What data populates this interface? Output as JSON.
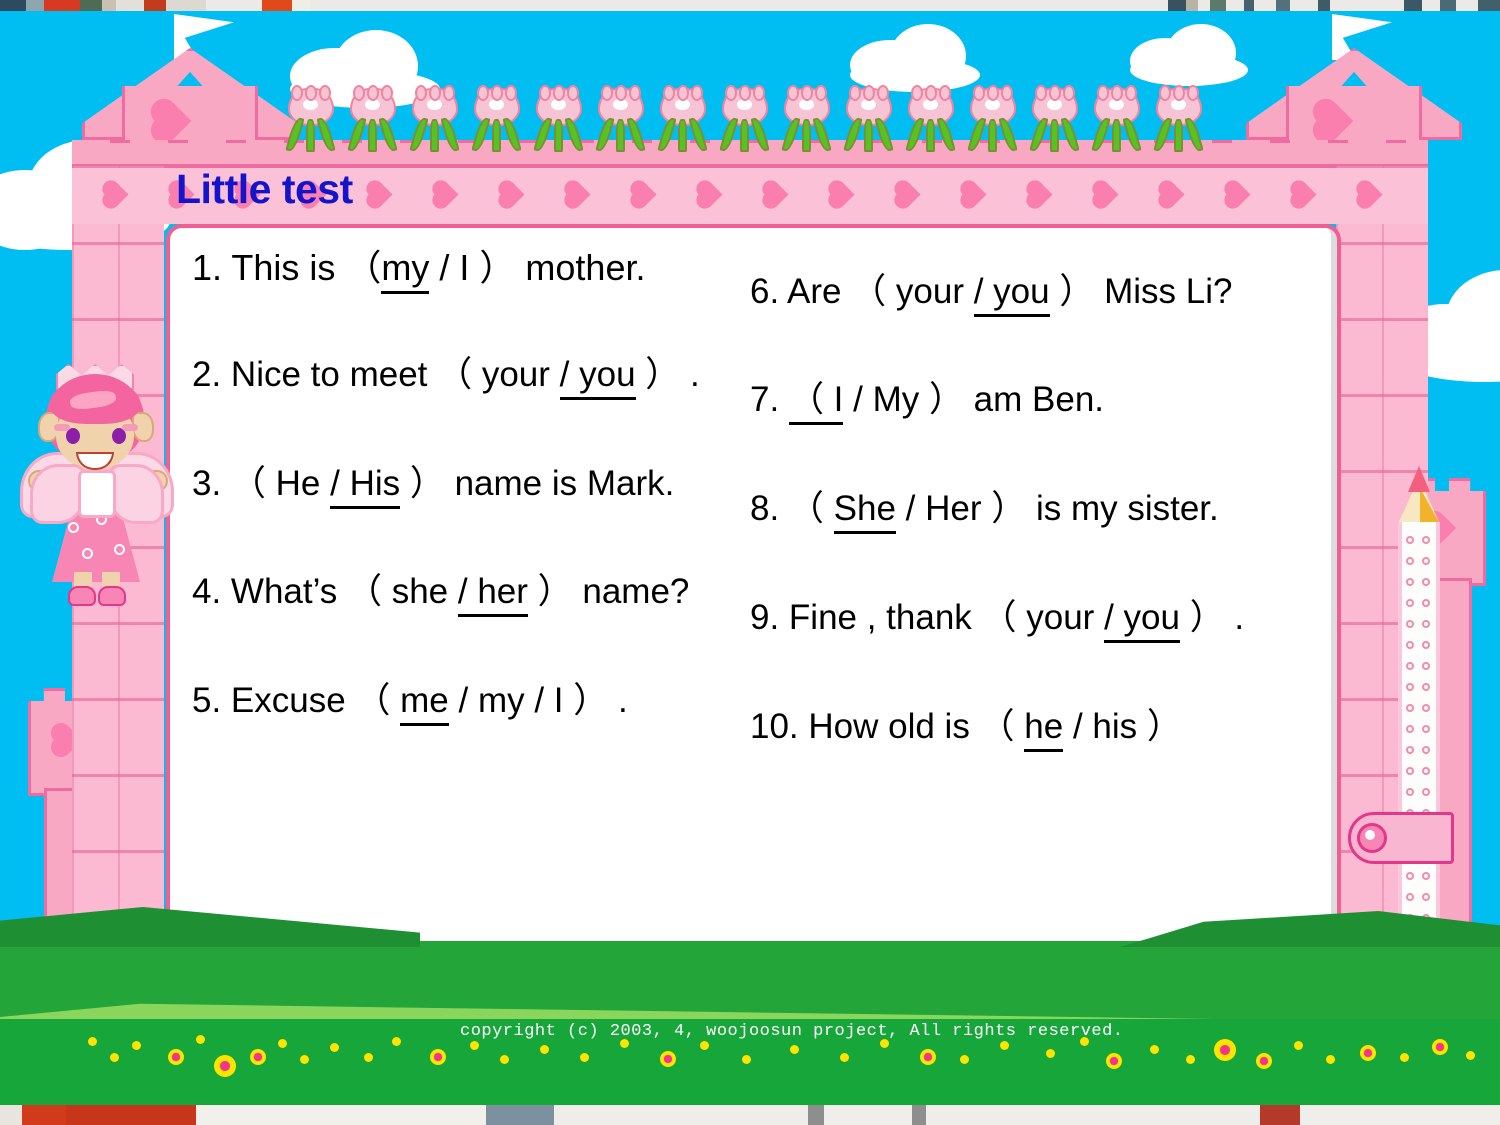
{
  "slide": {
    "title": "Little test",
    "title_color": "#1414cc",
    "sky_color": "#00bdf2",
    "castle_color": "#f9a8c4",
    "frame_color": "#fbb9d2",
    "grass_color": "#16a63a",
    "copyright": "copyright (c) 2003, 4, woojoosun project, All rights reserved."
  },
  "questions": {
    "left_column": [
      {
        "number": "1.",
        "segments": [
          {
            "text": "  This is  （",
            "underline": false
          },
          {
            "text": "my",
            "underline": true
          },
          {
            "text": " / I ）  mother.",
            "underline": false
          }
        ]
      },
      {
        "number": "2.",
        "segments": [
          {
            "text": " Nice to meet  （ your ",
            "underline": false
          },
          {
            "text": "/ you",
            "underline": true
          },
          {
            "text": " ）  .",
            "underline": false
          }
        ]
      },
      {
        "number": "3.",
        "segments": [
          {
            "text": "  （ He ",
            "underline": false
          },
          {
            "text": "/ His",
            "underline": true
          },
          {
            "text": " ）  name is Mark.",
            "underline": false
          }
        ]
      },
      {
        "number": "4.",
        "segments": [
          {
            "text": " What’s  （ she ",
            "underline": false
          },
          {
            "text": "/ her",
            "underline": true
          },
          {
            "text": " ）  name?",
            "underline": false
          }
        ]
      },
      {
        "number": "5.",
        "segments": [
          {
            "text": " Excuse  （ ",
            "underline": false
          },
          {
            "text": "me",
            "underline": true
          },
          {
            "text": " / my / I ）  .",
            "underline": false
          }
        ]
      }
    ],
    "right_column": [
      {
        "number": "6.",
        "segments": [
          {
            "text": " Are  （ your ",
            "underline": false
          },
          {
            "text": "/ you",
            "underline": true
          },
          {
            "text": " ）  Miss Li?",
            "underline": false
          }
        ]
      },
      {
        "number": "7.",
        "segments": [
          {
            "text": "  ",
            "underline": false
          },
          {
            "text": "（ I",
            "underline": true
          },
          {
            "text": " / My ）  am Ben.",
            "underline": false
          }
        ]
      },
      {
        "number": "8.",
        "segments": [
          {
            "text": "  （ ",
            "underline": false
          },
          {
            "text": "She",
            "underline": true
          },
          {
            "text": " / Her ）  is my sister.",
            "underline": false
          }
        ]
      },
      {
        "number": "9.",
        "segments": [
          {
            "text": " Fine , thank  （ your ",
            "underline": false
          },
          {
            "text": "/ you",
            "underline": true
          },
          {
            "text": " ）  .",
            "underline": false
          }
        ]
      },
      {
        "number": "10.",
        "segments": [
          {
            "text": " How old is  （ ",
            "underline": false
          },
          {
            "text": "he",
            "underline": true
          },
          {
            "text": " / his ）",
            "underline": false
          }
        ]
      }
    ]
  },
  "decorations": {
    "tulip_top_count": 15,
    "heart_band_count": 20,
    "character": "fairy-princess",
    "pencil": "pink-pencil",
    "clasp": "binder-clasp"
  }
}
